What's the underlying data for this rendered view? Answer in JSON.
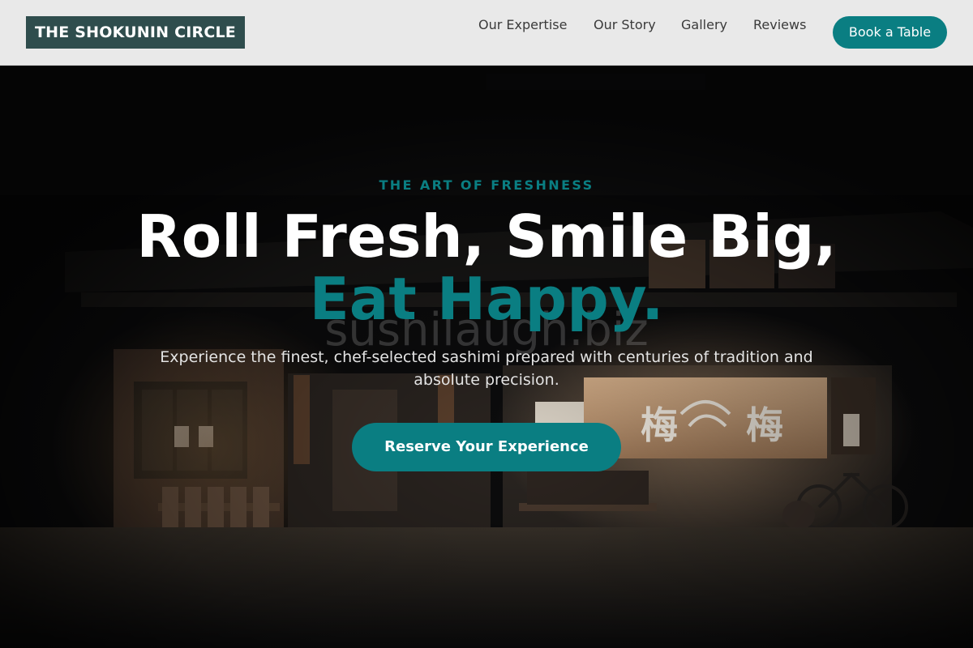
{
  "brand": {
    "name": "THE SHOKUNIN CIRCLE"
  },
  "nav": {
    "links": [
      "Our Expertise",
      "Our Story",
      "Gallery",
      "Reviews"
    ],
    "book_label": "Book a Table"
  },
  "hero": {
    "eyebrow": "THE ART OF FRESHNESS",
    "headline_line1": "Roll Fresh, Smile Big,",
    "headline_line2": "Eat Happy.",
    "watermark": "sushilaugh.biz",
    "subtitle": "Experience the finest, chef-selected sashimi prepared with centuries of tradition and absolute precision.",
    "cta_label": "Reserve Your Experience",
    "image_description": "night-street-japanese-shopfront-photo",
    "noren_lettering": [
      "梅",
      "梅"
    ]
  },
  "colors": {
    "accent": "#0a7e82",
    "logo_bg": "#2f4d4d",
    "nav_bg": "#e9e9e9",
    "hero_bg": "#0c0c0d",
    "text_light": "#ffffff"
  }
}
